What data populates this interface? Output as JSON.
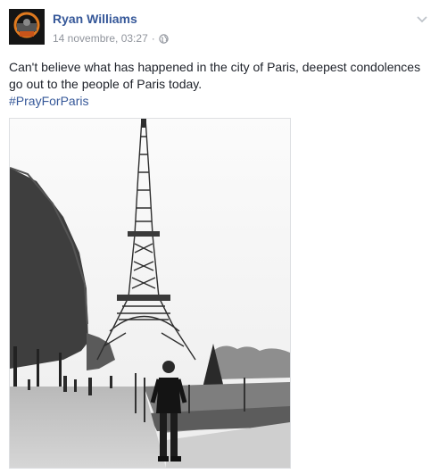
{
  "post": {
    "author": "Ryan Williams",
    "timestamp": "14 novembre, 03:27",
    "separator": "·",
    "privacy_icon": "globe-icon",
    "options_icon": "chevron-down-icon",
    "text_line1": "Can't believe what has happened in the city of Paris, deepest condolences",
    "text_line2": "go out to the people of Paris today.",
    "hashtag": "#PrayForParis",
    "photo_description_icon": "photo"
  },
  "colors": {
    "link": "#365899",
    "meta": "#90949c",
    "text": "#1d2129",
    "border": "#dddfe2"
  }
}
